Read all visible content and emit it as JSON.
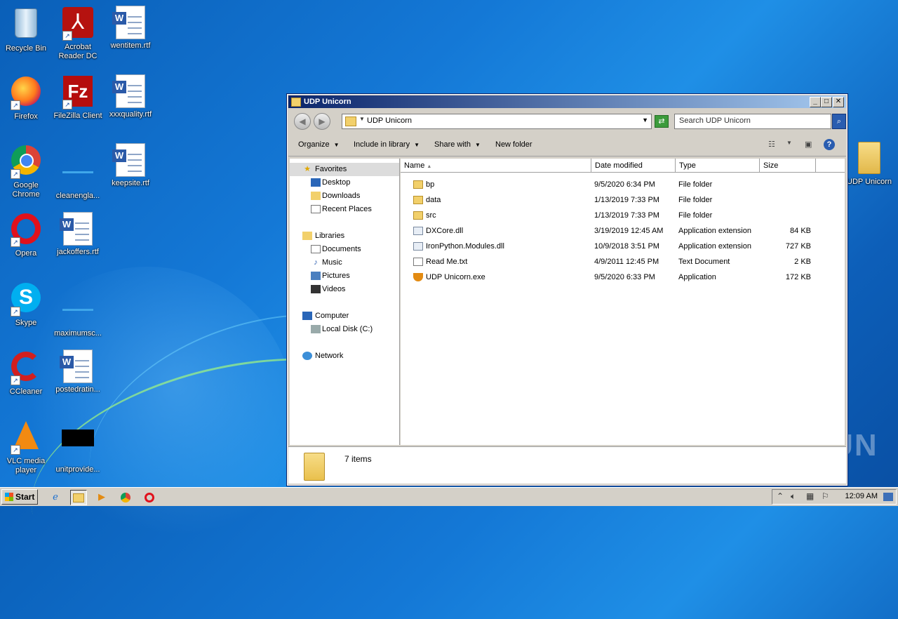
{
  "desktop": {
    "icons": [
      {
        "label": "Recycle Bin"
      },
      {
        "label": "Acrobat Reader DC"
      },
      {
        "label": "wentitem.rtf"
      },
      {
        "label": "Firefox"
      },
      {
        "label": "FileZilla Client"
      },
      {
        "label": "xxxquality.rtf"
      },
      {
        "label": "Google Chrome"
      },
      {
        "label": "cleanengla..."
      },
      {
        "label": "keepsite.rtf"
      },
      {
        "label": "Opera"
      },
      {
        "label": "jackoffers.rtf"
      },
      {
        "label": "Skype"
      },
      {
        "label": "maximumsc..."
      },
      {
        "label": "CCleaner"
      },
      {
        "label": "postedratin..."
      },
      {
        "label": "VLC media player"
      },
      {
        "label": "unitprovide..."
      },
      {
        "label": "UDP Unicorn"
      }
    ],
    "watermark": "ANY RUN"
  },
  "window": {
    "title": "UDP Unicorn",
    "address": "UDP Unicorn",
    "search_placeholder": "Search UDP Unicorn",
    "toolbar": {
      "organize": "Organize",
      "include": "Include in library",
      "share": "Share with",
      "new_folder": "New folder"
    },
    "nav": {
      "favorites": "Favorites",
      "desktop": "Desktop",
      "downloads": "Downloads",
      "recent": "Recent Places",
      "libraries": "Libraries",
      "documents": "Documents",
      "music": "Music",
      "pictures": "Pictures",
      "videos": "Videos",
      "computer": "Computer",
      "local_disk": "Local Disk (C:)",
      "network": "Network"
    },
    "columns": {
      "name": "Name",
      "date": "Date modified",
      "type": "Type",
      "size": "Size"
    },
    "files": [
      {
        "name": "bp",
        "date": "9/5/2020 6:34 PM",
        "type": "File folder",
        "size": ""
      },
      {
        "name": "data",
        "date": "1/13/2019 7:33 PM",
        "type": "File folder",
        "size": ""
      },
      {
        "name": "src",
        "date": "1/13/2019 7:33 PM",
        "type": "File folder",
        "size": ""
      },
      {
        "name": "DXCore.dll",
        "date": "3/19/2019 12:45 AM",
        "type": "Application extension",
        "size": "84 KB"
      },
      {
        "name": "IronPython.Modules.dll",
        "date": "10/9/2018 3:51 PM",
        "type": "Application extension",
        "size": "727 KB"
      },
      {
        "name": "Read Me.txt",
        "date": "4/9/2011 12:45 PM",
        "type": "Text Document",
        "size": "2 KB"
      },
      {
        "name": "UDP Unicorn.exe",
        "date": "9/5/2020 6:33 PM",
        "type": "Application",
        "size": "172 KB"
      }
    ],
    "status": "7 items"
  },
  "taskbar": {
    "start": "Start",
    "clock": "12:09 AM"
  }
}
